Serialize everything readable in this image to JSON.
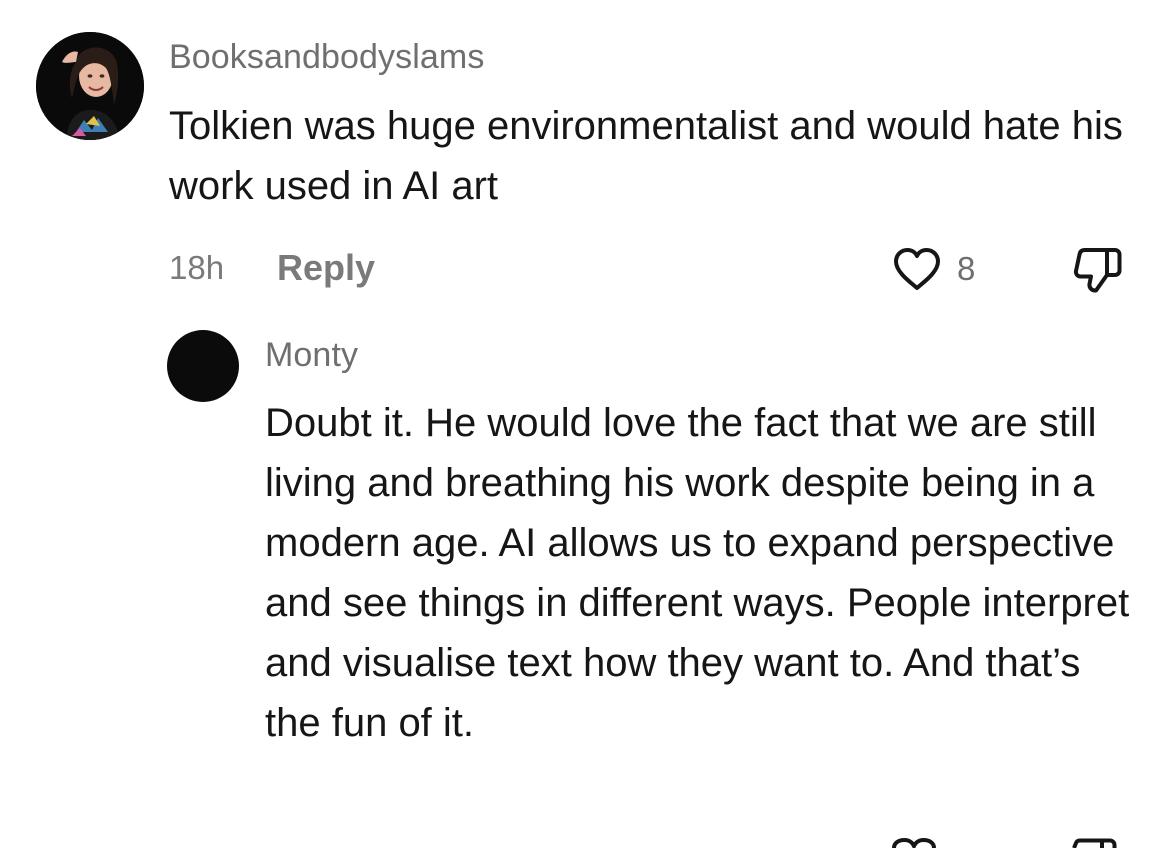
{
  "comment": {
    "username": "Booksandbodyslams",
    "text": "Tolkien was huge environmentalist and would hate his work used in AI art",
    "timestamp": "18h",
    "reply_label": "Reply",
    "like_count": "8",
    "like_icon": "heart-outline-icon",
    "dislike_icon": "thumbs-down-icon"
  },
  "reply": {
    "username": "Monty",
    "text": "Doubt it. He would love the fact that we are still living and breathing his work despite being in a modern age. AI allows us to expand perspective and see things in different ways. People interpret and visualise text how they want to. And that’s the fun of it."
  },
  "colors": {
    "text_primary": "#161616",
    "text_secondary": "#6f6f6f",
    "icon_stroke": "#161616",
    "background": "#ffffff"
  }
}
